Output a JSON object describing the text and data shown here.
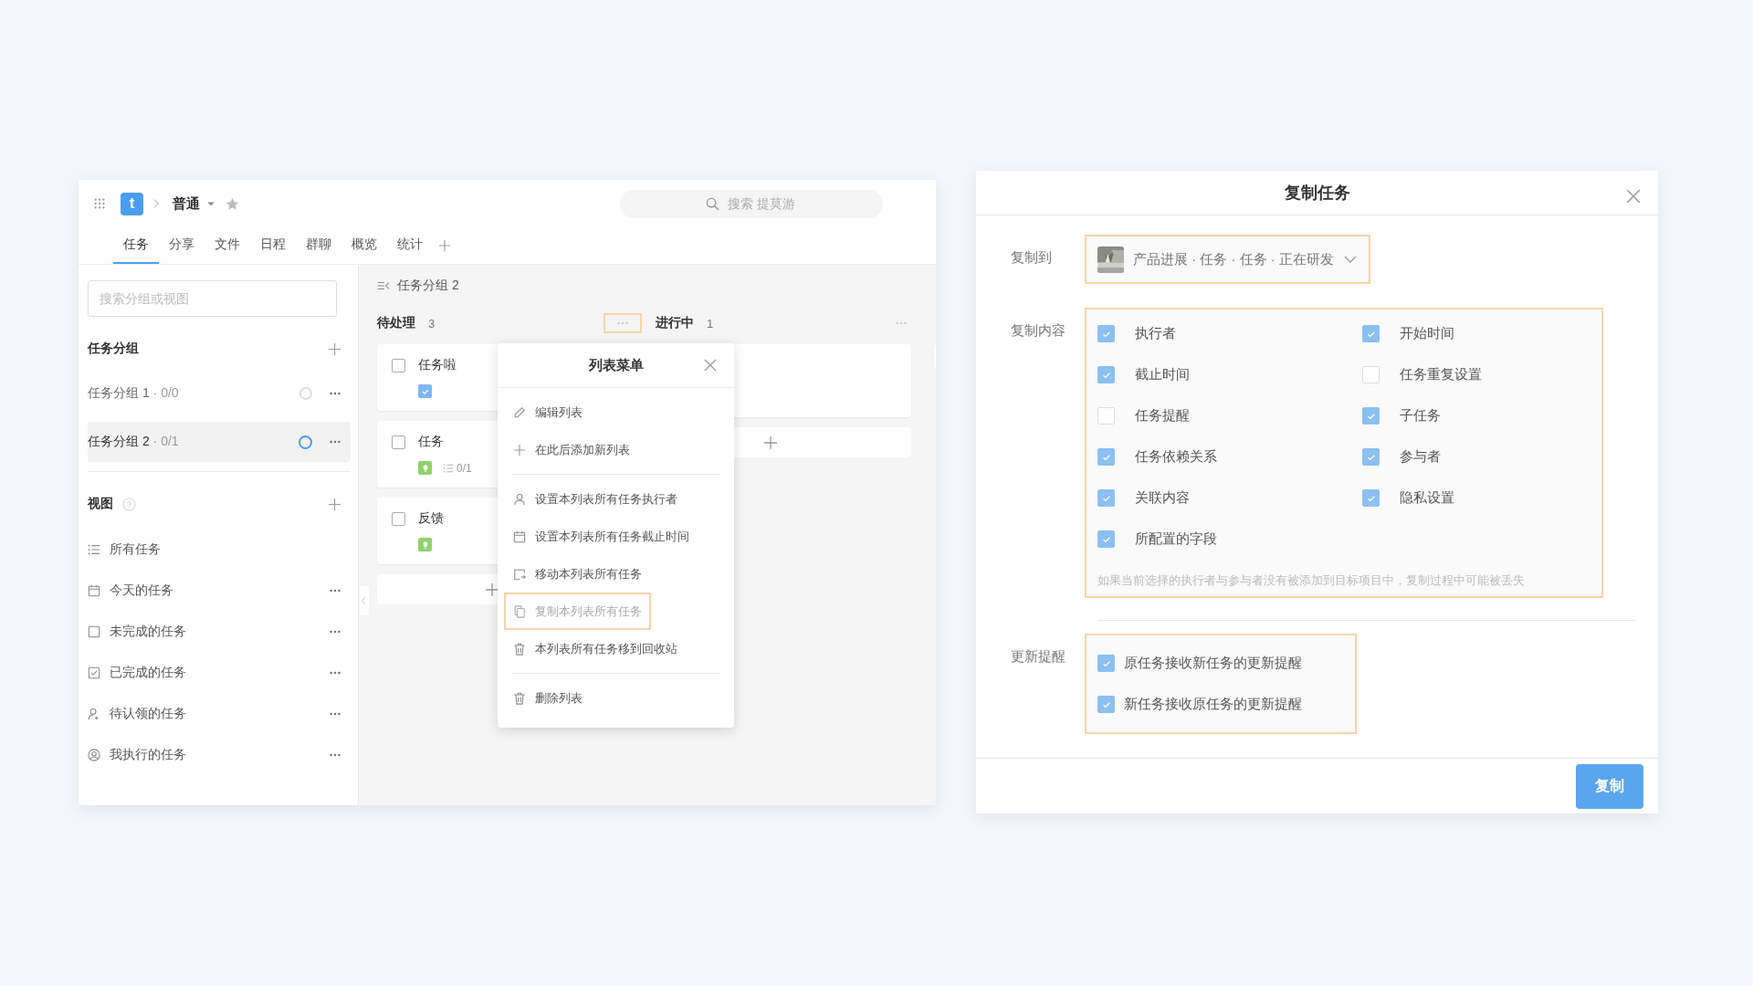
{
  "project": {
    "logo": "t",
    "name": "普通",
    "search": {
      "placeholder": "搜索 提莫游"
    }
  },
  "tabs": [
    {
      "label": "任务",
      "selected": true
    },
    {
      "label": "分享",
      "selected": false
    },
    {
      "label": "文件",
      "selected": false
    },
    {
      "label": "日程",
      "selected": false
    },
    {
      "label": "群聊",
      "selected": false
    },
    {
      "label": "概览",
      "selected": false
    },
    {
      "label": "统计",
      "selected": false
    }
  ],
  "sidebar": {
    "search": {
      "placeholder": "搜索分组或视图"
    },
    "groups_title": "任务分组",
    "groups": [
      {
        "label": "任务分组 1",
        "count": "· 0/0",
        "selected": false
      },
      {
        "label": "任务分组 2",
        "count": "· 0/1",
        "selected": true
      }
    ],
    "views_title": "视图",
    "views": [
      {
        "label": "所有任务",
        "kind": "list",
        "has_menu": false
      },
      {
        "label": "今天的任务",
        "kind": "calendar",
        "has_menu": true
      },
      {
        "label": "未完成的任务",
        "kind": "square",
        "has_menu": true
      },
      {
        "label": "已完成的任务",
        "kind": "checked",
        "has_menu": true
      },
      {
        "label": "待认领的任务",
        "kind": "unclaimed",
        "has_menu": true
      },
      {
        "label": "我执行的任务",
        "kind": "mine",
        "has_menu": true
      }
    ]
  },
  "board": {
    "breadcrumb": "任务分组 2",
    "columns": [
      {
        "title": "待处理",
        "count": "3",
        "menu_highlighted": true,
        "cards": [
          {
            "title": "任务啦",
            "done": false,
            "tags": [
              {
                "kind": "check"
              }
            ]
          },
          {
            "title": "任务",
            "done": false,
            "tags": [
              {
                "kind": "idea"
              }
            ],
            "subtasks": "0/1"
          },
          {
            "title": "反馈",
            "done": false,
            "tags": [
              {
                "kind": "idea"
              }
            ]
          }
        ]
      },
      {
        "title": "进行中",
        "count": "1",
        "menu_highlighted": false,
        "cards": [
          {
            "kind": "blank"
          }
        ]
      }
    ]
  },
  "list_menu": {
    "title": "列表菜单",
    "groups": [
      [
        {
          "label": "编辑列表",
          "kind": "edit",
          "highlighted": false
        },
        {
          "label": "在此后添加新列表",
          "kind": "add",
          "highlighted": false
        }
      ],
      [
        {
          "label": "设置本列表所有任务执行者",
          "kind": "assignee",
          "highlighted": false
        },
        {
          "label": "设置本列表所有任务截止时间",
          "kind": "due",
          "highlighted": false
        },
        {
          "label": "移动本列表所有任务",
          "kind": "move",
          "highlighted": false
        },
        {
          "label": "复制本列表所有任务",
          "kind": "copy",
          "highlighted": true
        },
        {
          "label": "本列表所有任务移到回收站",
          "kind": "trash",
          "highlighted": false
        }
      ],
      [
        {
          "label": "删除列表",
          "kind": "delete",
          "highlighted": false
        }
      ]
    ]
  },
  "copy_dialog": {
    "title": "复制任务",
    "target": {
      "label": "复制到",
      "value": "产品进展 · 任务 · 任务 · 正在研发",
      "highlighted": true
    },
    "content": {
      "label": "复制内容",
      "highlighted": true,
      "options": [
        {
          "label": "执行者",
          "checked": true
        },
        {
          "label": "开始时间",
          "checked": true
        },
        {
          "label": "截止时间",
          "checked": true
        },
        {
          "label": "任务重复设置",
          "checked": false
        },
        {
          "label": "任务提醒",
          "checked": false
        },
        {
          "label": "子任务",
          "checked": true
        },
        {
          "label": "任务依赖关系",
          "checked": true
        },
        {
          "label": "参与者",
          "checked": true
        },
        {
          "label": "关联内容",
          "checked": true
        },
        {
          "label": "隐私设置",
          "checked": true
        },
        {
          "label": "所配置的字段",
          "checked": true
        }
      ],
      "note": "如果当前选择的执行者与参与者没有被添加到目标项目中，复制过程中可能被丢失"
    },
    "reminders": {
      "label": "更新提醒",
      "highlighted": true,
      "options": [
        {
          "label": "原任务接收新任务的更新提醒",
          "checked": true
        },
        {
          "label": "新任务接收原任务的更新提醒",
          "checked": true
        }
      ]
    },
    "button": "复制"
  }
}
